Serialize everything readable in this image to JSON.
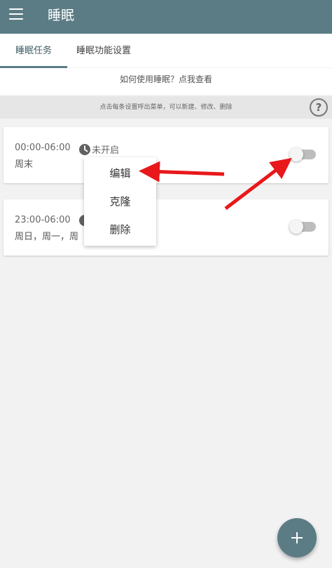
{
  "header": {
    "title": "睡眠",
    "menu_icon": "hamburger-menu-icon"
  },
  "tabs": [
    {
      "label": "睡眠任务",
      "active": true
    },
    {
      "label": "睡眠功能设置",
      "active": false
    }
  ],
  "help_link": "如何使用睡眠？点我查看",
  "hint": "点击每条设置呼出菜单，可以新建、修改、删除",
  "help_icon": "question-circle-icon",
  "tasks": [
    {
      "time": "00:00-06:00",
      "days": "周末",
      "status": "未开启",
      "enabled": false
    },
    {
      "time": "23:00-06:00",
      "days": "周日，周一，周",
      "status": "",
      "enabled": false
    }
  ],
  "popup_menu": {
    "items": [
      "编辑",
      "克隆",
      "删除"
    ]
  },
  "fab": {
    "icon": "plus-icon"
  },
  "colors": {
    "primary": "#5c7c85",
    "annotation_arrow": "#e8181b"
  }
}
